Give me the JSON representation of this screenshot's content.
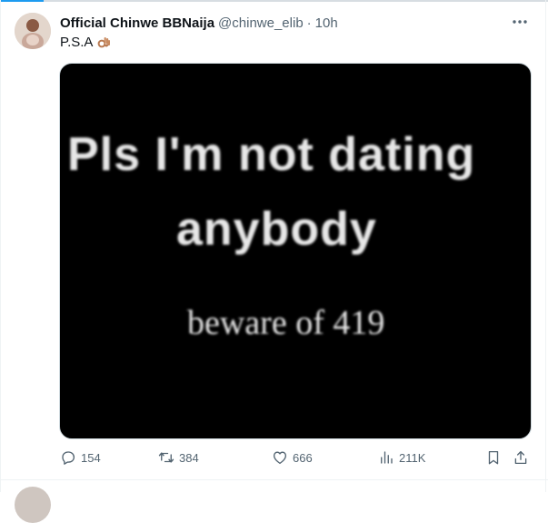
{
  "tweet": {
    "author_name": "Official Chinwe BBNaija",
    "handle": "@chinwe_elib",
    "separator": "·",
    "time": "10h",
    "text": "P.S.A",
    "emoji_icon": "ok-hand-emoji",
    "media": {
      "line1": "Pls I'm not dating",
      "line2": "anybody",
      "line3": "beware of 419"
    }
  },
  "actions": {
    "replies": "154",
    "reposts": "384",
    "likes": "666",
    "views": "211K"
  },
  "colors": {
    "text_primary": "#0f1419",
    "text_secondary": "#536471",
    "media_background": "#000000",
    "accent": "#1d9bf0"
  }
}
